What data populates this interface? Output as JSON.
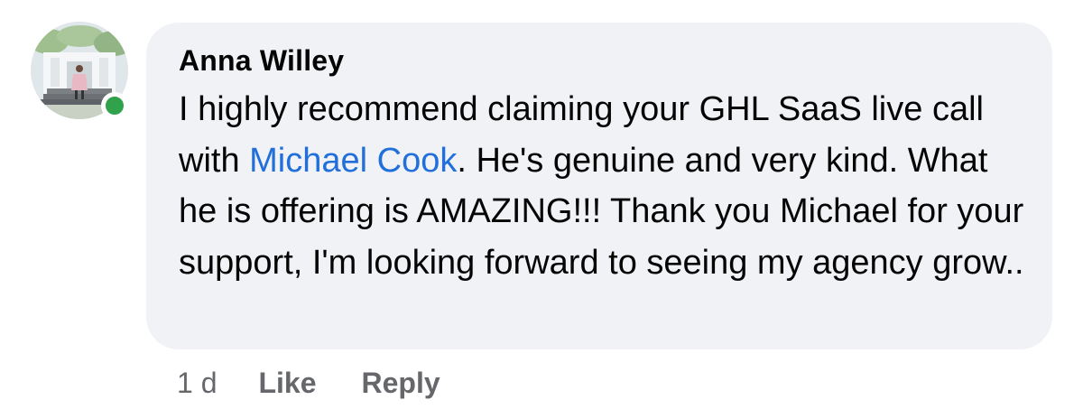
{
  "comment": {
    "author_name": "Anna Willey",
    "text_before_mention": "I highly recommend claiming your GHL SaaS live call with ",
    "mention": "Michael Cook",
    "text_after_mention": ". He's genuine and very kind. What he is offering is AMAZING!!!  Thank you Michael for your support, I'm looking forward to seeing my agency grow..",
    "timestamp": "1 d",
    "like_label": "Like",
    "reply_label": "Reply",
    "online": true
  },
  "colors": {
    "bubble_bg": "#f0f2f5",
    "mention": "#216fdb",
    "online_dot": "#31a24c",
    "meta_text": "#65676b"
  }
}
